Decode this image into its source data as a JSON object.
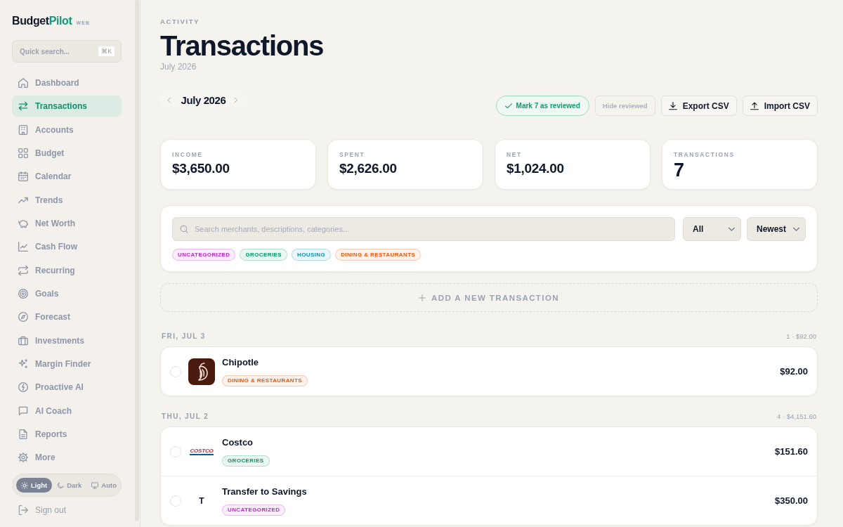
{
  "sidebar": {
    "brand": {
      "name": "Budget",
      "accent": "Pilot",
      "tag": "WEB"
    },
    "quick_search": {
      "placeholder": "Quick search...",
      "shortcut": "⌘K"
    },
    "nav": [
      {
        "label": "Dashboard",
        "selected": false
      },
      {
        "label": "Transactions",
        "selected": true
      },
      {
        "label": "Accounts",
        "selected": false
      },
      {
        "label": "Budget",
        "selected": false
      },
      {
        "label": "Calendar",
        "selected": false
      },
      {
        "label": "Trends",
        "selected": false
      },
      {
        "label": "Net Worth",
        "selected": false
      },
      {
        "label": "Cash Flow",
        "selected": false
      },
      {
        "label": "Recurring",
        "selected": false
      },
      {
        "label": "Goals",
        "selected": false
      },
      {
        "label": "Forecast",
        "selected": false
      },
      {
        "label": "Investments",
        "selected": false
      },
      {
        "label": "Margin Finder",
        "selected": false
      },
      {
        "label": "Proactive AI",
        "selected": false
      },
      {
        "label": "AI Coach",
        "selected": false
      },
      {
        "label": "Reports",
        "selected": false
      },
      {
        "label": "More",
        "selected": false
      }
    ],
    "theme": [
      {
        "label": "Light",
        "selected": true
      },
      {
        "label": "Dark",
        "selected": false
      },
      {
        "label": "Auto",
        "selected": false
      }
    ],
    "sign_out": "Sign out"
  },
  "header": {
    "eyebrow": "ACTIVITY",
    "title": "Transactions",
    "subtitle": "July 2026"
  },
  "period": {
    "label": "July 2026"
  },
  "actions": [
    {
      "label": "Mark 7 as reviewed",
      "kind": "review",
      "disabled": false
    },
    {
      "label": "Hide reviewed",
      "kind": "toggle",
      "disabled": true
    },
    {
      "label": "Export CSV",
      "kind": "export",
      "disabled": false
    },
    {
      "label": "Import CSV",
      "kind": "import",
      "disabled": false
    }
  ],
  "stats": [
    {
      "label": "INCOME",
      "value": "$3,650.00",
      "kind": "money"
    },
    {
      "label": "SPENT",
      "value": "$2,626.00",
      "kind": "money"
    },
    {
      "label": "NET",
      "value": "$1,024.00",
      "kind": "money"
    },
    {
      "label": "TRANSACTIONS",
      "value": "7",
      "kind": "count"
    }
  ],
  "filters": {
    "search": {
      "placeholder": "Search merchants, descriptions, categories..."
    },
    "selects": [
      {
        "value": "All"
      },
      {
        "value": "Newest"
      }
    ],
    "chips": [
      {
        "label": "UNCATEGORIZED",
        "color": "#c026d3"
      },
      {
        "label": "GROCERIES",
        "color": "#059669"
      },
      {
        "label": "HOUSING",
        "color": "#0e8fb0"
      },
      {
        "label": "DINING & RESTAURANTS",
        "color": "#ea580c"
      }
    ]
  },
  "add_transaction": "ADD A NEW TRANSACTION",
  "groups": [
    {
      "date": "FRI, JUL 3",
      "summary": "1 · $92.00",
      "transactions": [
        {
          "name": "Chipotle",
          "logo": {
            "kind": "tile"
          },
          "category": {
            "label": "DINING & RESTAURANTS",
            "color": "#ea580c"
          },
          "amount": "$92.00",
          "checked": false
        }
      ]
    },
    {
      "date": "THU, JUL 2",
      "summary": "4 · $4,151.60",
      "transactions": [
        {
          "name": "Costco",
          "logo": {
            "kind": "wordmark",
            "text": "COSTCO"
          },
          "category": {
            "label": "GROCERIES",
            "color": "#059669"
          },
          "amount": "$151.60",
          "checked": false
        },
        {
          "name": "Transfer to Savings",
          "logo": {
            "kind": "letter",
            "text": "T"
          },
          "category": {
            "label": "UNCATEGORIZED",
            "color": "#c026d3"
          },
          "amount": "$350.00",
          "checked": false
        }
      ]
    }
  ]
}
